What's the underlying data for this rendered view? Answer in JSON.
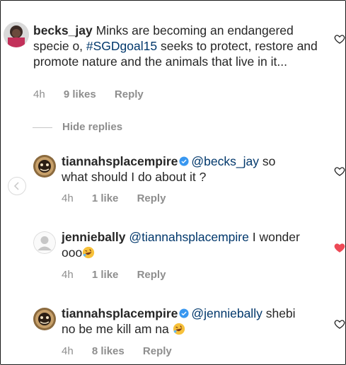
{
  "comments": [
    {
      "user": "becks_jay",
      "text_parts": [
        "Minks are becoming an endangered specie o, ",
        "#SGDgoal15",
        " seeks to protect, restore and promote nature and the animals that live in it..."
      ],
      "time": "4h",
      "likes": "9 likes",
      "reply": "Reply",
      "liked": false
    },
    {
      "user": "tiannahsplacempire",
      "mention": "@becks_jay",
      "text": " so what should I do about it ?",
      "time": "4h",
      "likes": "1 like",
      "reply": "Reply",
      "liked": false
    },
    {
      "user": "jenniebally",
      "mention": "@tiannahsplacempire",
      "text": " I wonder ooo",
      "time": "4h",
      "likes": "1 like",
      "reply": "Reply",
      "liked": true
    },
    {
      "user": "tiannahsplacempire",
      "mention": "@jenniebally",
      "text": " shebi no be me kill am na ",
      "time": "4h",
      "likes": "8 likes",
      "reply": "Reply",
      "liked": false
    }
  ],
  "hide_replies": "Hide replies",
  "icons": {
    "heart": "heart-outline-icon",
    "heart_liked": "heart-filled-icon",
    "verified": "verified-badge-icon",
    "emoji": "rofl-emoji-icon",
    "nav": "chevron-left-icon"
  },
  "colors": {
    "text": "#262626",
    "meta": "#8e8e8e",
    "mention": "#00376b",
    "liked": "#ed4956",
    "verified": "#3897f0"
  }
}
